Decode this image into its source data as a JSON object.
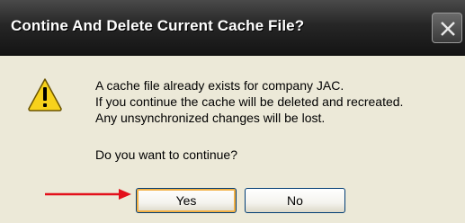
{
  "dialog": {
    "title": "Contine And Delete Current Cache File?",
    "close_icon": "close-icon",
    "message_lines": [
      "A cache file already exists for company JAC.",
      "If you continue the cache will be deleted and recreated.",
      "Any unsynchronized changes will be lost."
    ],
    "question": "Do you want to continue?",
    "icon": "warning-icon",
    "buttons": {
      "yes": "Yes",
      "no": "No"
    },
    "annotation": "red-arrow-icon"
  }
}
